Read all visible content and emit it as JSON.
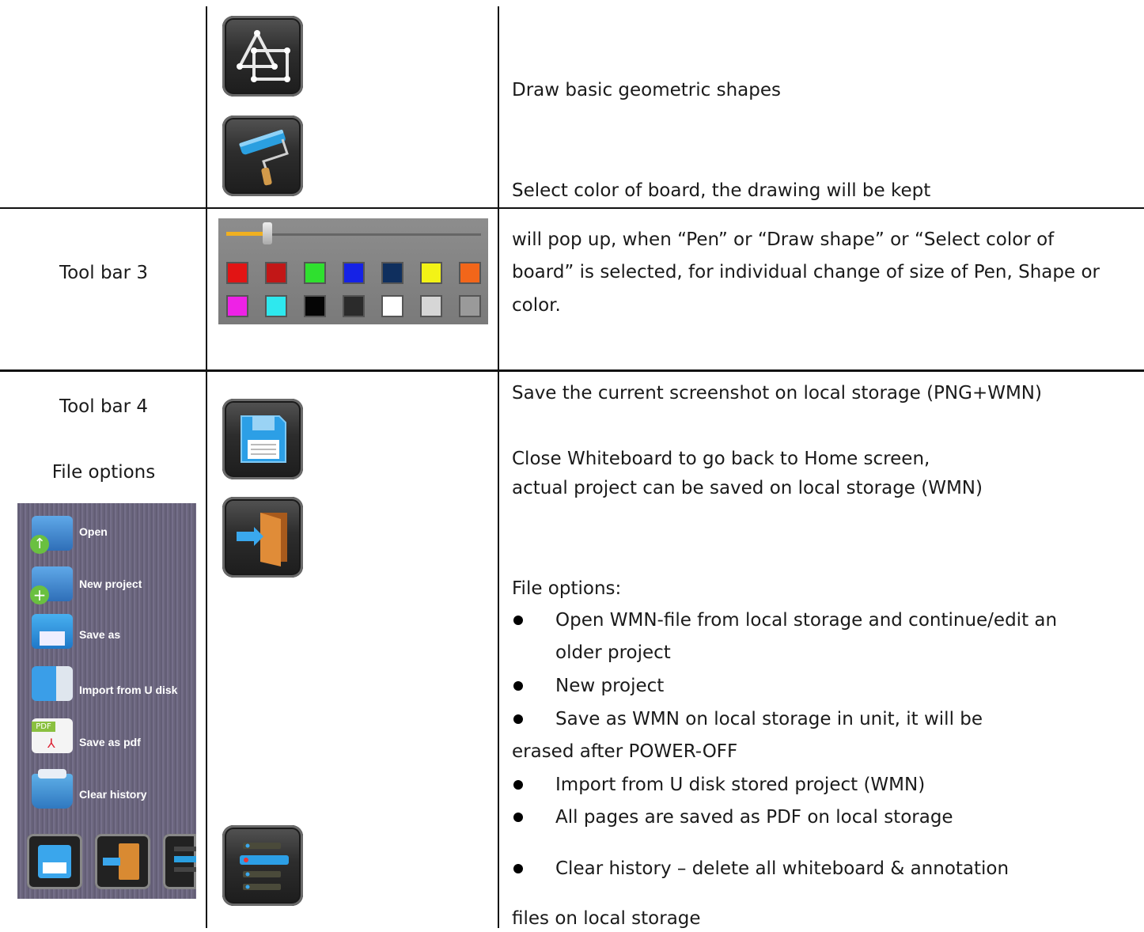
{
  "rows": {
    "row1": {
      "shape_icon": "draw-shape-icon",
      "board_icon": "paint-roller-icon",
      "desc_shapes": "Draw basic geometric shapes",
      "desc_board": "Select color of board, the drawing will be kept"
    },
    "row2": {
      "label": "Tool bar 3",
      "desc_lines": [
        "will pop up, when “Pen” or “Draw shape” or “Select color of",
        "board” is selected, for individual change of size of Pen, Shape or",
        "color."
      ],
      "colors": [
        "#e21414",
        "#c21717",
        "#2fe02f",
        "#1522e6",
        "#0f2f5e",
        "#f3f316",
        "#f2661a",
        "#ee22e6",
        "#2ee8ee",
        "#050505",
        "#2b2b2b",
        "#ffffff",
        "#d6d6d6",
        "#9a9a9a"
      ]
    },
    "row3": {
      "label": "Tool bar 4",
      "sublabel": "File options",
      "desc_save": "Save the current screenshot on local storage (PNG+WMN)",
      "desc_close_1": "Close Whiteboard to go back to Home screen,",
      "desc_close_2": "actual project can be saved on local storage (WMN)",
      "file_options_title": "File options:",
      "bullets": [
        "Open WMN-file from local storage and continue/edit an",
        "older project",
        "New project",
        "Save as WMN on local storage in unit, it will be",
        "erased after POWER-OFF",
        "Import from U disk stored project (WMN)",
        "All pages are saved as PDF on local storage",
        "Clear history – delete all whiteboard & annotation",
        "files on local storage"
      ],
      "menu_items": [
        "Open",
        "New project",
        "Save as",
        "Import from U disk",
        "Save as pdf",
        "Clear history"
      ],
      "menu_pdf_badge": "PDF",
      "icons": [
        "save-icon",
        "exit-door-icon",
        "menu-list-icon"
      ]
    }
  }
}
